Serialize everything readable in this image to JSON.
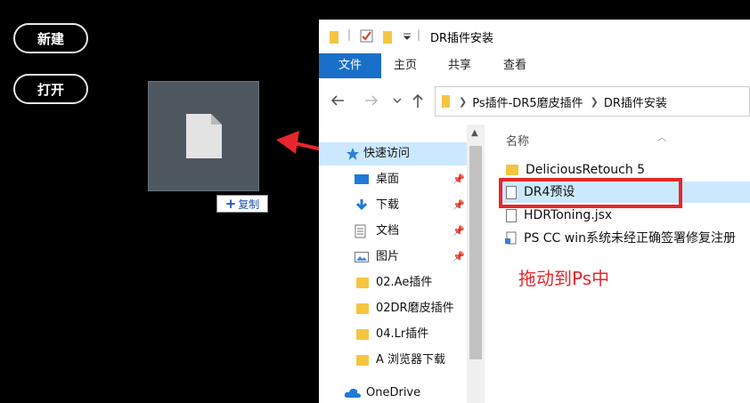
{
  "app": {
    "new_button": "新建",
    "open_button": "打开",
    "copy_tooltip": "复制",
    "copy_plus": "+"
  },
  "explorer": {
    "title": "DR插件安装",
    "ribbon_tabs": [
      "文件",
      "主页",
      "共享",
      "查看"
    ],
    "breadcrumb": [
      "Ps插件-DR5磨皮插件",
      "DR插件安装"
    ],
    "column_name": "名称",
    "nav": {
      "quick_access": "快速访问",
      "items": [
        "桌面",
        "下载",
        "文档",
        "图片",
        "02.Ae插件",
        "02DR磨皮插件",
        "04.Lr插件",
        "A 浏览器下载"
      ],
      "onedrive": "OneDrive"
    },
    "files": [
      "DeliciousRetouch 5",
      "DR4预设",
      "HDRToning.jsx",
      "PS CC  win系统未经正确签署修复注册"
    ],
    "drag_hint": "拖动到Ps中"
  },
  "colors": {
    "accent": "#1a6fc9",
    "highlight": "#cce8ff",
    "annotation_red": "#e8262b"
  }
}
